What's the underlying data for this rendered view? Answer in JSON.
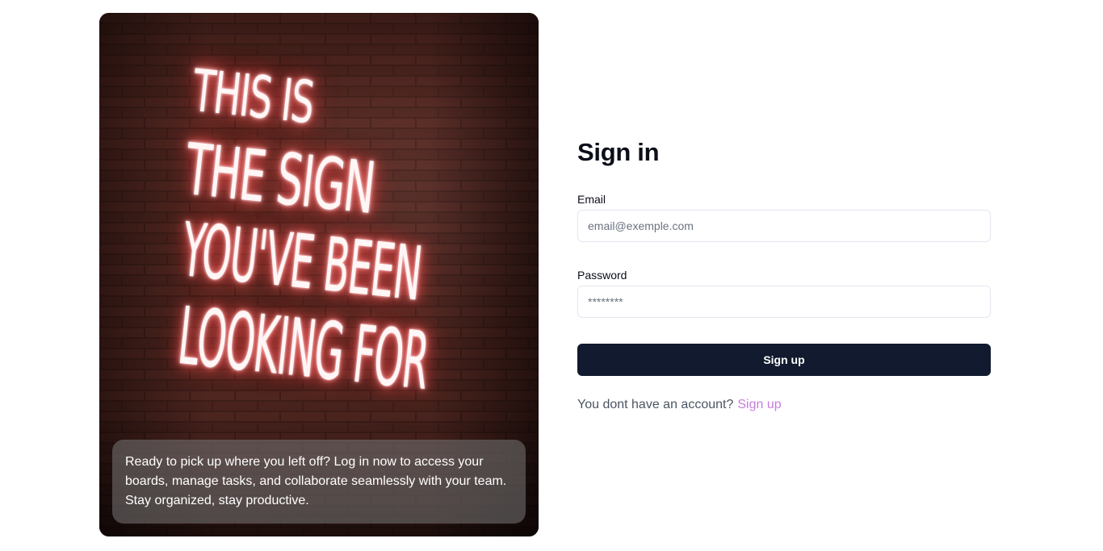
{
  "hero": {
    "neon_lines": [
      "THIS IS",
      "THE SIGN",
      "YOU'VE BEEN",
      "LOOKING FOR"
    ],
    "caption": "Ready to pick up where you left off? Log in now to access your boards, manage tasks, and collaborate seamlessly with your team. Stay organized, stay productive."
  },
  "form": {
    "title": "Sign in",
    "email": {
      "label": "Email",
      "placeholder": "email@exemple.com",
      "value": ""
    },
    "password": {
      "label": "Password",
      "placeholder": "********",
      "value": ""
    },
    "submit_label": "Sign up",
    "alt_text": "You dont have an account?",
    "alt_link_label": "Sign up"
  },
  "colors": {
    "primary_button": "#111a2e",
    "link": "#c77ddb",
    "neon_glow": "#ff5d5d"
  }
}
